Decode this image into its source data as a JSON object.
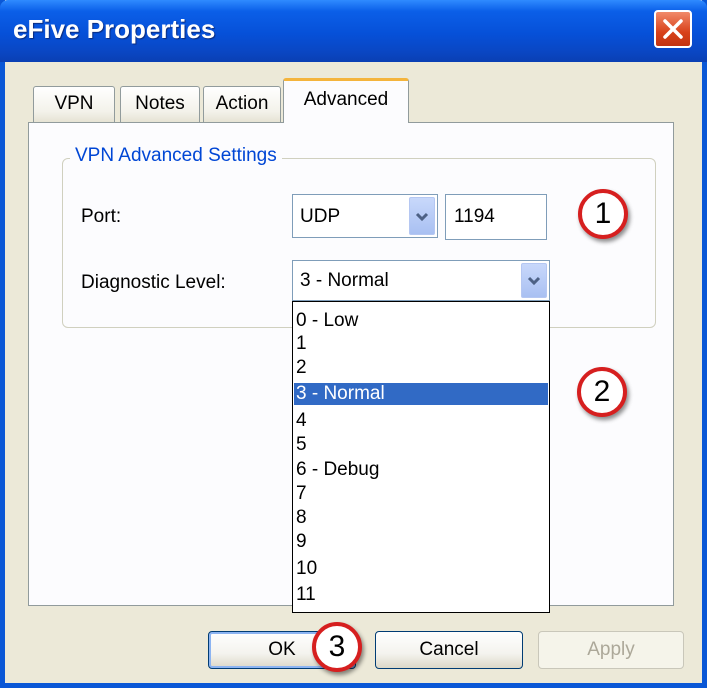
{
  "window": {
    "title": "eFive Properties"
  },
  "tabs": [
    {
      "label": "VPN"
    },
    {
      "label": "Notes"
    },
    {
      "label": "Action"
    },
    {
      "label": "Advanced"
    }
  ],
  "group": {
    "label": "VPN Advanced Settings",
    "port_label": "Port:",
    "protocol_value": "UDP",
    "port_value": "1194",
    "diag_label": "Diagnostic Level:",
    "diag_value": "3 - Normal"
  },
  "dropdown": {
    "options": [
      "0 - Low",
      "1",
      "2",
      "3 - Normal",
      "4",
      "5",
      "6 - Debug",
      "7",
      "8",
      "9",
      "10",
      "11"
    ],
    "selected": "3 - Normal"
  },
  "buttons": {
    "ok": "OK",
    "cancel": "Cancel",
    "apply": "Apply"
  },
  "callouts": [
    "1",
    "2",
    "3"
  ],
  "icons": {
    "close": "close-icon",
    "dropdown": "chevron-down-icon"
  },
  "colors": {
    "title_bar": "#0650d8",
    "selection": "#316ac5",
    "callout_ring": "#d61f1f",
    "active_tab_accent": "#f4b43c"
  }
}
